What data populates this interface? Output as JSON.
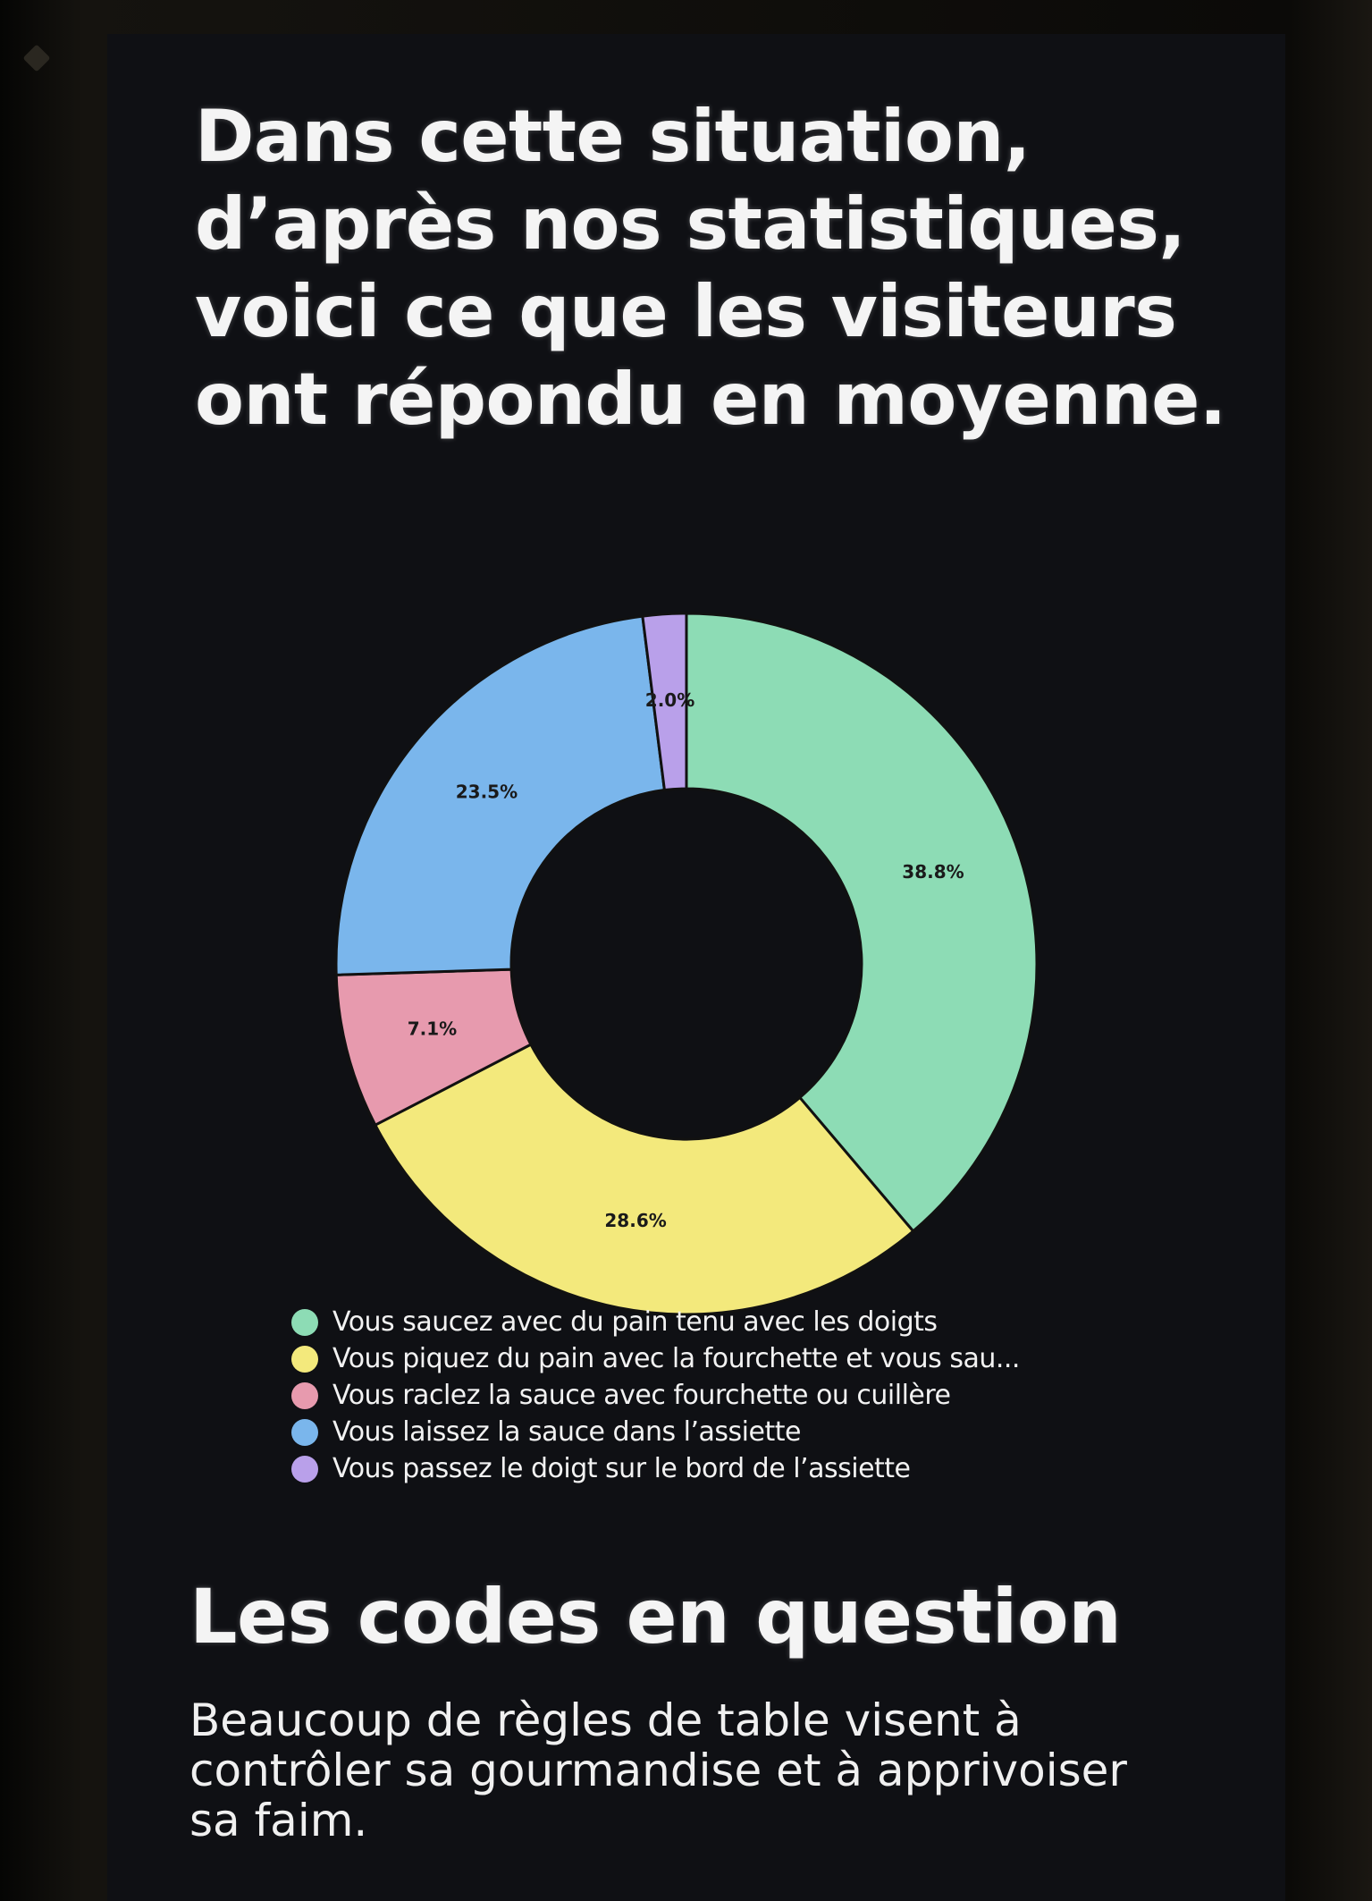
{
  "title": "Dans cette situation, d’après nos statistiques, voici ce que les visiteurs ont répondu en moyenne.",
  "chart_data": {
    "type": "pie",
    "donut": true,
    "start": "top, clockwise",
    "slices": [
      {
        "label": "Vous saucez avec du pain tenu avec les doigts",
        "value": 38.8,
        "value_label": "38.8%",
        "color": "#8ddcb5"
      },
      {
        "label": "Vous piquez du pain avec la fourchette et vous sau...",
        "value": 28.6,
        "value_label": "28.6%",
        "color": "#f3e97c"
      },
      {
        "label": "Vous raclez la sauce avec fourchette ou cuillère",
        "value": 7.1,
        "value_label": "7.1%",
        "color": "#e79aae"
      },
      {
        "label": "Vous laissez la sauce dans l’assiette",
        "value": 23.5,
        "value_label": "23.5%",
        "color": "#7ab6ec"
      },
      {
        "label": "Vous passez le doigt sur le bord de l’assiette",
        "value": 2.0,
        "value_label": "2.0%",
        "color": "#b9a0ea"
      }
    ],
    "legend_position": "bottom"
  },
  "section": {
    "title": "Les codes en question",
    "body": "Beaucoup de règles de table visent à contrôler sa gourmandise et à apprivoiser sa faim."
  }
}
